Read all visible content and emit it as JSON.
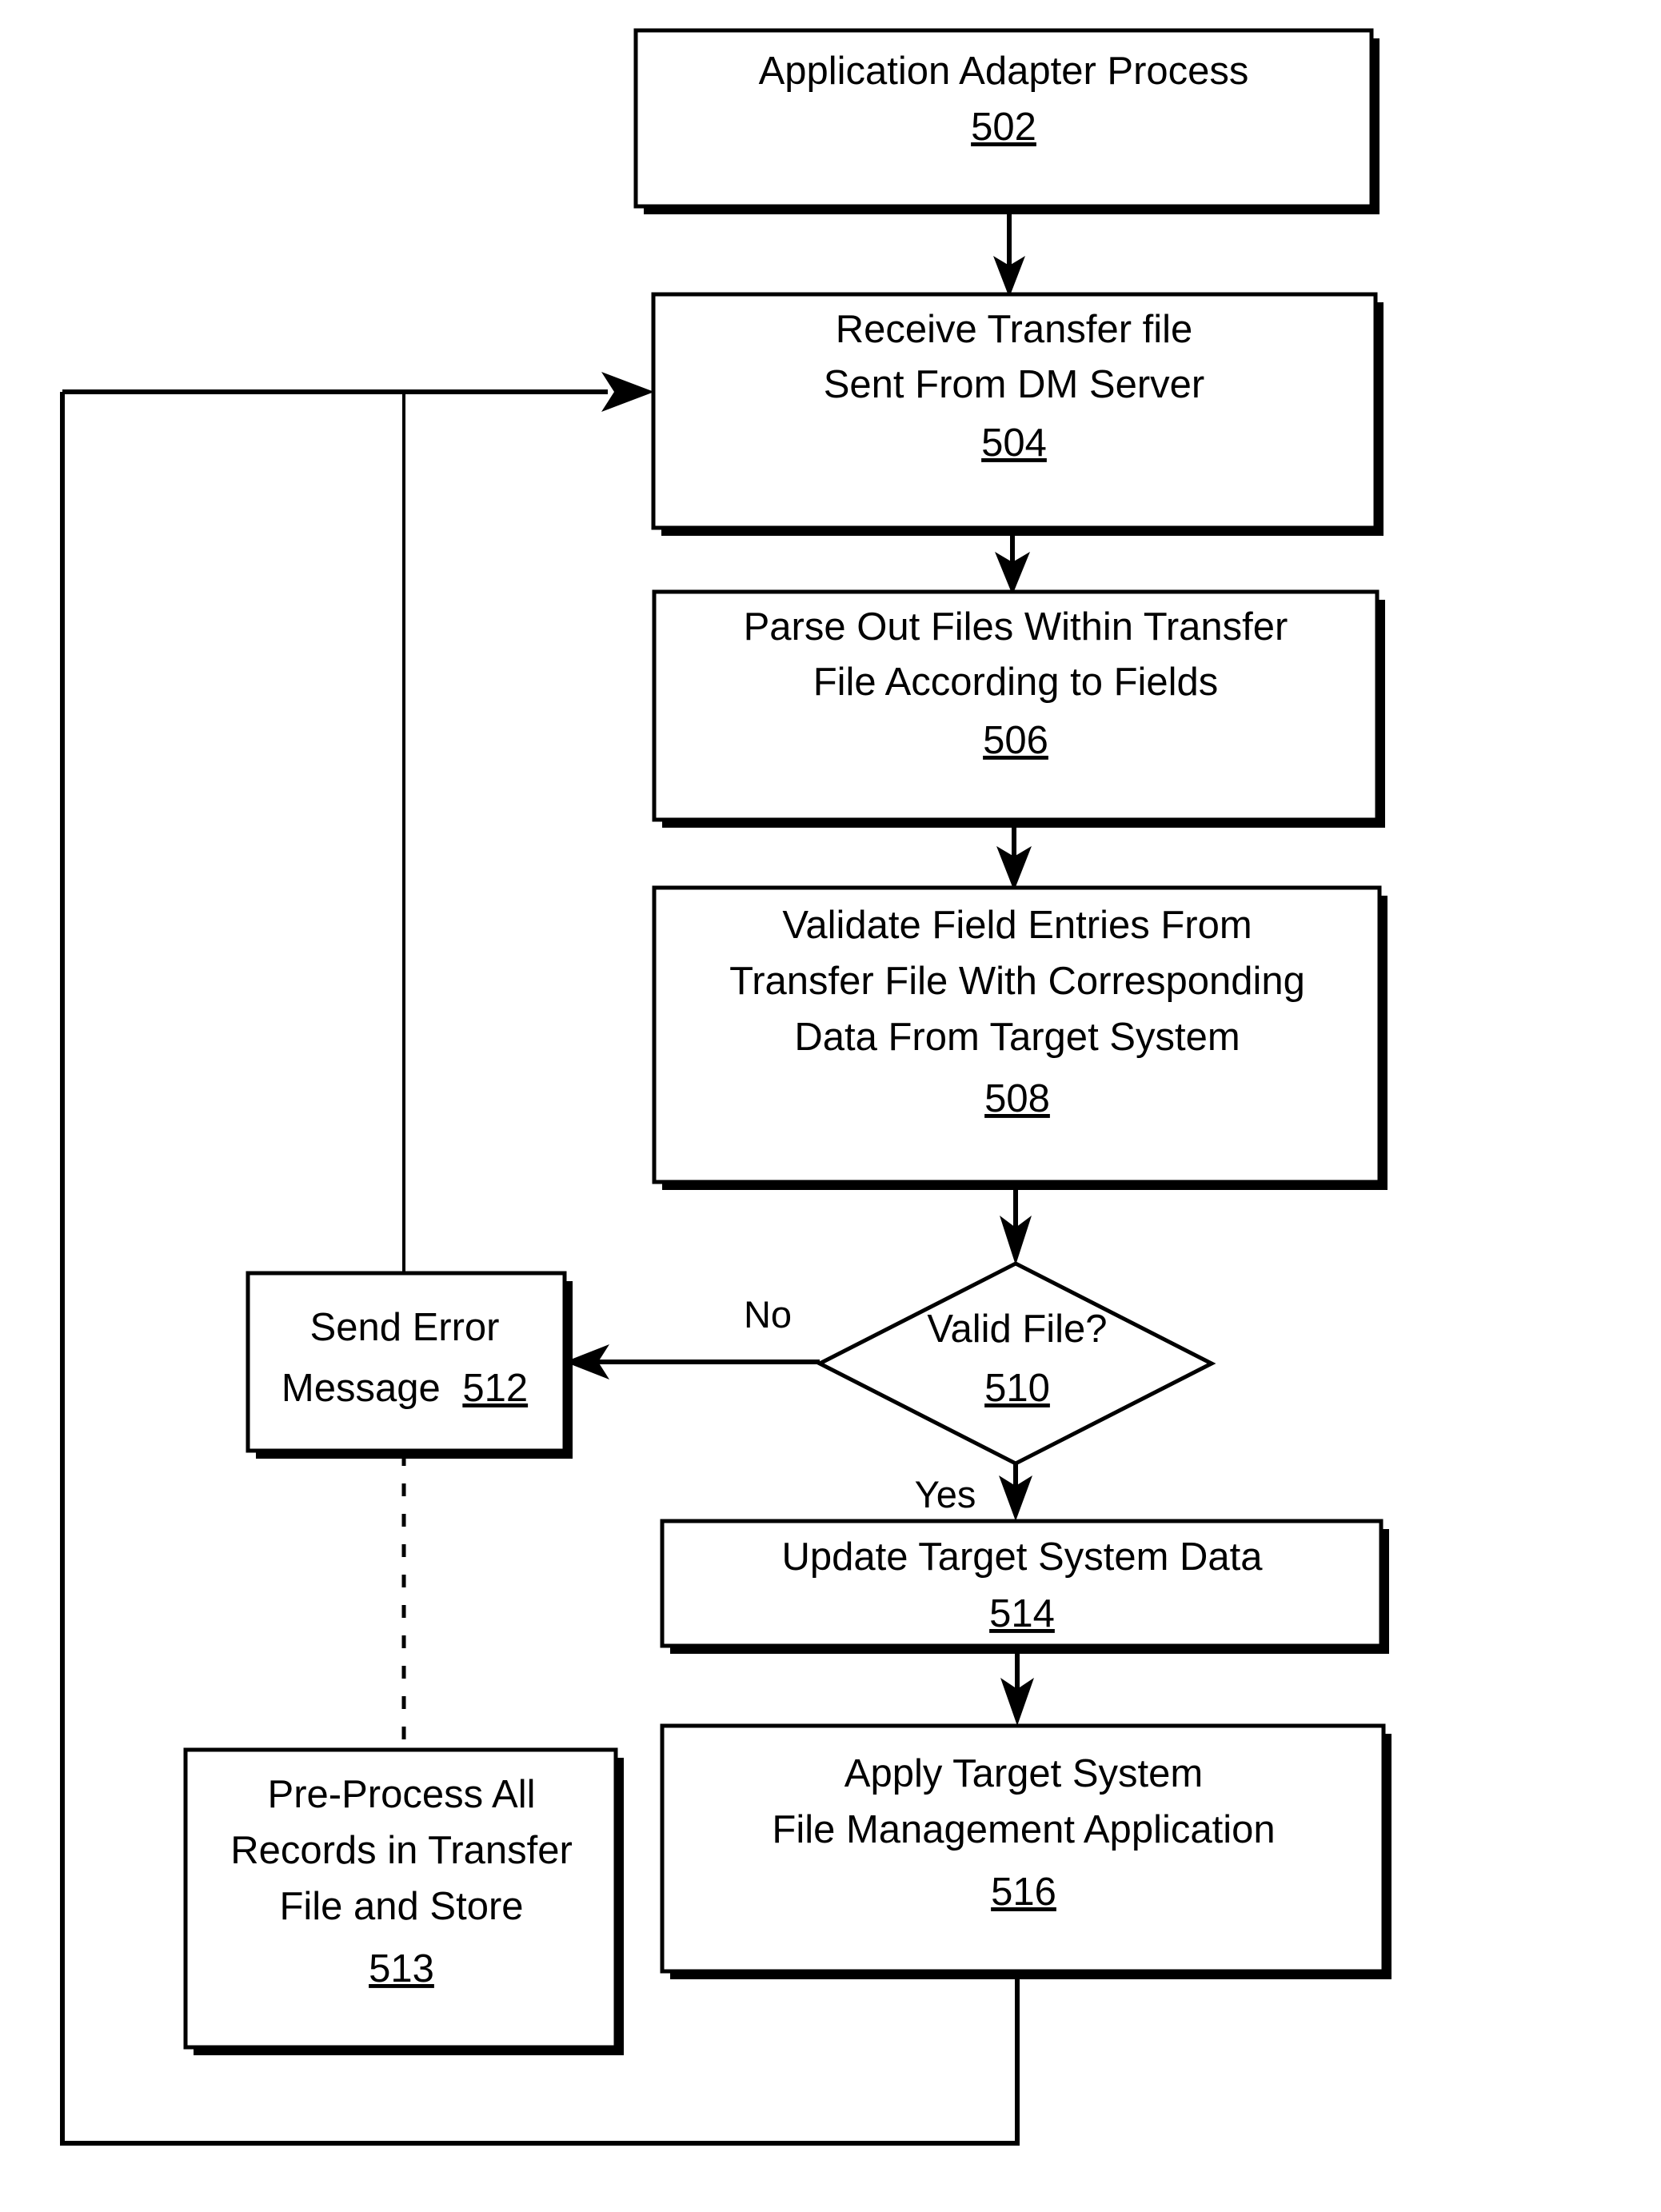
{
  "figure": {
    "type": "flowchart",
    "title": "Application Adapter Process flowchart",
    "nodes": [
      {
        "id": "n502",
        "shape": "process",
        "ref": "502",
        "lines": [
          "Application Adapter Process"
        ]
      },
      {
        "id": "n504",
        "shape": "process",
        "ref": "504",
        "lines": [
          "Receive Transfer file",
          "Sent From DM Server"
        ]
      },
      {
        "id": "n506",
        "shape": "process",
        "ref": "506",
        "lines": [
          "Parse Out Files Within Transfer",
          "File According to Fields"
        ]
      },
      {
        "id": "n508",
        "shape": "process",
        "ref": "508",
        "lines": [
          "Validate Field Entries From",
          "Transfer File With Corresponding",
          "Data From Target System"
        ]
      },
      {
        "id": "n510",
        "shape": "decision",
        "ref": "510",
        "lines": [
          "Valid File?"
        ]
      },
      {
        "id": "n512",
        "shape": "process",
        "ref": "512",
        "lines": [
          "Send Error",
          "Message 512"
        ],
        "inline_ref": true
      },
      {
        "id": "n513",
        "shape": "process",
        "ref": "513",
        "lines": [
          "Pre-Process All",
          "Records in Transfer",
          "File and Store"
        ]
      },
      {
        "id": "n514",
        "shape": "process",
        "ref": "514",
        "lines": [
          "Update Target System Data"
        ]
      },
      {
        "id": "n516",
        "shape": "process",
        "ref": "516",
        "lines": [
          "Apply Target System",
          "File Management Application"
        ]
      }
    ],
    "edge_labels": {
      "no": "No",
      "yes": "Yes"
    },
    "colors": {
      "stroke": "#000000",
      "fill": "#ffffff",
      "text": "#000000"
    }
  },
  "nodes": {
    "n502": {
      "line1": "Application Adapter Process",
      "ref": "502"
    },
    "n504": {
      "line1": "Receive Transfer file",
      "line2": "Sent From DM Server",
      "ref": "504"
    },
    "n506": {
      "line1": "Parse Out Files Within Transfer",
      "line2": "File According to Fields",
      "ref": "506"
    },
    "n508": {
      "line1": "Validate Field Entries From",
      "line2": "Transfer File With Corresponding",
      "line3": "Data From Target System",
      "ref": "508"
    },
    "n510": {
      "line1": "Valid File?",
      "ref": "510"
    },
    "n512": {
      "line1": "Send Error",
      "line2a": "Message",
      "ref": "512"
    },
    "n513": {
      "line1": "Pre-Process All",
      "line2": "Records in Transfer",
      "line3": "File and Store",
      "ref": "513"
    },
    "n514": {
      "line1": "Update Target System Data",
      "ref": "514"
    },
    "n516": {
      "line1": "Apply Target System",
      "line2": "File Management Application",
      "ref": "516"
    }
  },
  "labels": {
    "no": "No",
    "yes": "Yes"
  }
}
